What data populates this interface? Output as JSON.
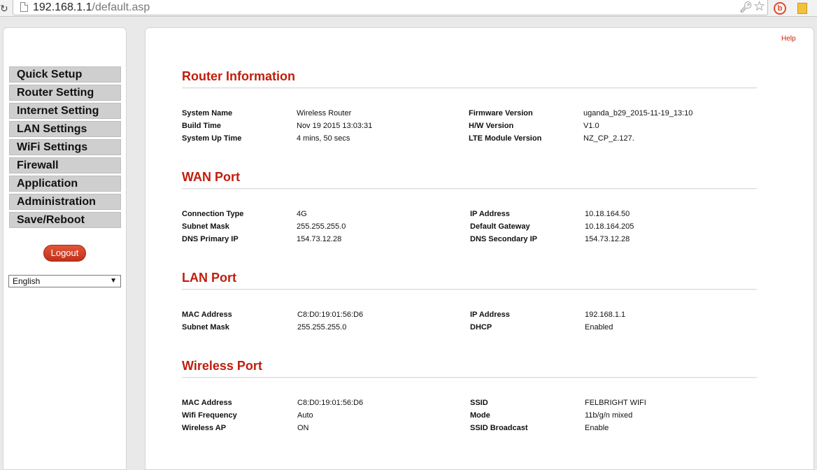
{
  "browser": {
    "url_host": "192.168.1.1",
    "url_path": "/default.asp",
    "reload_icon": "reload-icon",
    "ext_label": "b"
  },
  "sidebar": {
    "items": [
      {
        "label": "Quick Setup"
      },
      {
        "label": "Router Setting"
      },
      {
        "label": "Internet Setting"
      },
      {
        "label": "LAN Settings"
      },
      {
        "label": "WiFi Settings"
      },
      {
        "label": "Firewall"
      },
      {
        "label": "Application"
      },
      {
        "label": "Administration"
      },
      {
        "label": "Save/Reboot"
      }
    ],
    "logout_label": "Logout",
    "language": "English"
  },
  "main": {
    "help_label": "Help",
    "sections": {
      "router": {
        "title": "Router Information",
        "rows": [
          {
            "l1": "System Name",
            "v1": "Wireless Router",
            "l2": "Firmware Version",
            "v2": "uganda_b29_2015-11-19_13:10"
          },
          {
            "l1": "Build Time",
            "v1": "Nov 19 2015 13:03:31",
            "l2": "H/W Version",
            "v2": "V1.0"
          },
          {
            "l1": "System Up Time",
            "v1": "4 mins, 50 secs",
            "l2": "LTE Module Version",
            "v2": "NZ_CP_2.127."
          }
        ]
      },
      "wan": {
        "title": "WAN Port",
        "rows": [
          {
            "l1": "Connection Type",
            "v1": "4G",
            "l2": "IP Address",
            "v2": "10.18.164.50"
          },
          {
            "l1": "Subnet Mask",
            "v1": "255.255.255.0",
            "l2": "Default Gateway",
            "v2": "10.18.164.205"
          },
          {
            "l1": "DNS Primary IP",
            "v1": "154.73.12.28",
            "l2": "DNS Secondary IP",
            "v2": "154.73.12.28"
          }
        ]
      },
      "lan": {
        "title": "LAN Port",
        "rows": [
          {
            "l1": "MAC Address",
            "v1": "C8:D0:19:01:56:D6",
            "l2": "IP Address",
            "v2": "192.168.1.1"
          },
          {
            "l1": "Subnet Mask",
            "v1": "255.255.255.0",
            "l2": "DHCP",
            "v2": "Enabled"
          }
        ]
      },
      "wireless": {
        "title": "Wireless Port",
        "rows": [
          {
            "l1": "MAC Address",
            "v1": "C8:D0:19:01:56:D6",
            "l2": "SSID",
            "v2": "FELBRIGHT WIFI"
          },
          {
            "l1": "Wifi Frequency",
            "v1": "Auto",
            "l2": "Mode",
            "v2": "11b/g/n mixed"
          },
          {
            "l1": "Wireless AP",
            "v1": "ON",
            "l2": "SSID Broadcast",
            "v2": "Enable"
          }
        ]
      }
    }
  },
  "colors": {
    "accent": "#c01e0c",
    "nav_bg": "#cfcfcf",
    "logout_bg": "#d2432a"
  }
}
